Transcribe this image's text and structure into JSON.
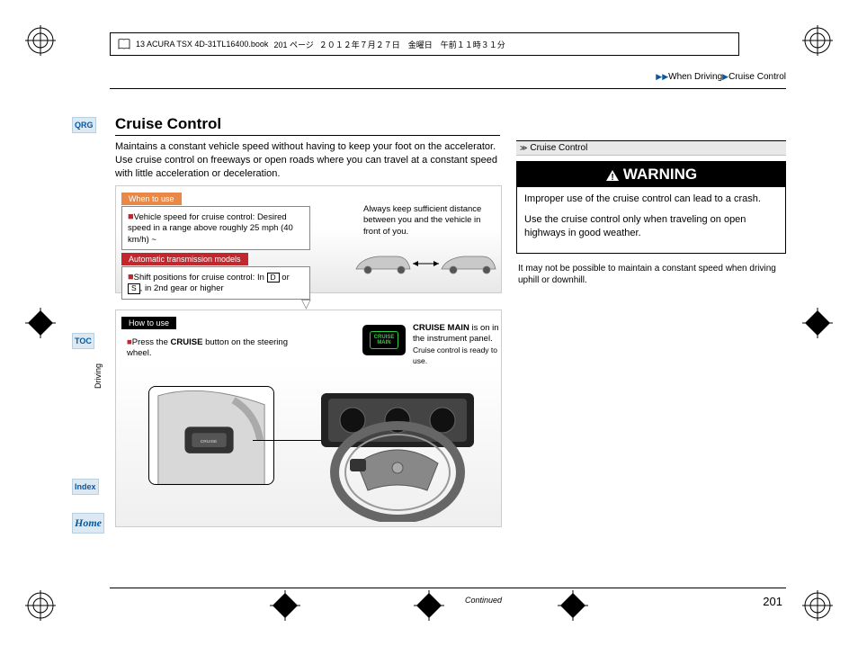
{
  "header": {
    "filename": "13 ACURA TSX 4D-31TL16400.book",
    "page_token": "201 ページ",
    "date": "２０１２年７月２７日　金曜日　午前１１時３１分"
  },
  "breadcrumb": {
    "a": "When Driving",
    "b": "Cruise Control"
  },
  "nav": {
    "qrg": "QRG",
    "toc": "TOC",
    "index": "Index",
    "home": "Home",
    "section": "Driving"
  },
  "title": "Cruise Control",
  "intro": "Maintains a constant vehicle speed without having to keep your foot on the accelerator. Use cruise control on freeways or open roads where you can travel at a constant speed with little acceleration or deceleration.",
  "d1": {
    "tag_when": "When to use",
    "speed": "Vehicle speed for cruise control: Desired speed in a range above roughly 25 mph (40 km/h) ~",
    "tag_auto": "Automatic transmission models",
    "shift_a": "Shift positions for cruise control: In ",
    "gear_d": "D",
    "shift_or": " or ",
    "gear_s": "S",
    "shift_b": ", in 2nd gear or higher",
    "distance": "Always keep sufficient distance between you and the vehicle in front of you."
  },
  "d2": {
    "tag_how": "How to use",
    "press_a": "Press the ",
    "press_b": "CRUISE",
    "press_c": " button on the steering wheel.",
    "badge": "CRUISE MAIN",
    "panel_a": "CRUISE MAIN",
    "panel_b": " is on in the instrument panel.",
    "panel_c": "Cruise control is ready to use.",
    "btn_label": "CRUISE"
  },
  "right": {
    "sec": "Cruise Control",
    "warn_title": "WARNING",
    "warn_p1": "Improper use of the cruise control can lead to a crash.",
    "warn_p2": "Use the cruise control only when traveling on open highways in good weather.",
    "note": "It may not be possible to maintain a constant speed when driving uphill or downhill."
  },
  "footer": {
    "continued": "Continued",
    "page": "201"
  }
}
